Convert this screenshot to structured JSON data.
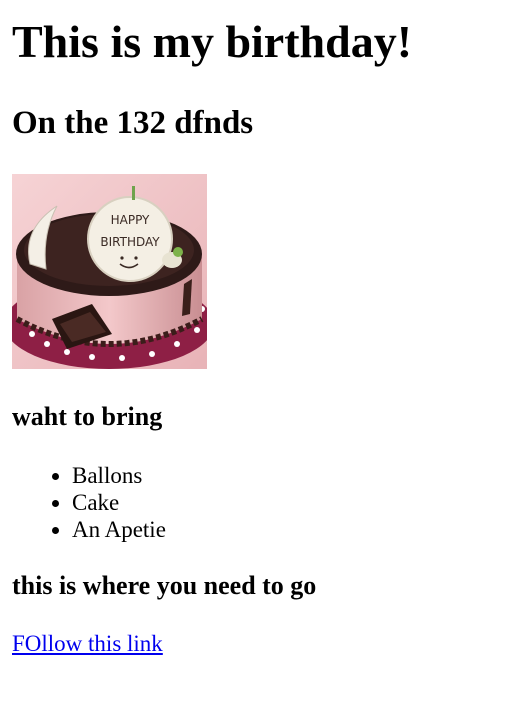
{
  "heading": "This is my birthday!",
  "subheading": "On the 132 dfnds",
  "image": {
    "icon": "birthday-cake-image",
    "cake_text_line1": "HAPPY",
    "cake_text_line2": "BIRTHDAY"
  },
  "bring": {
    "title": "waht to bring",
    "items": [
      "Ballons",
      "Cake",
      "An Apetie"
    ]
  },
  "location": {
    "title": "this is where you need to go",
    "link_text": "FOllow this link"
  },
  "colors": {
    "link": "#0000ee",
    "text": "#000000",
    "background": "#ffffff"
  }
}
